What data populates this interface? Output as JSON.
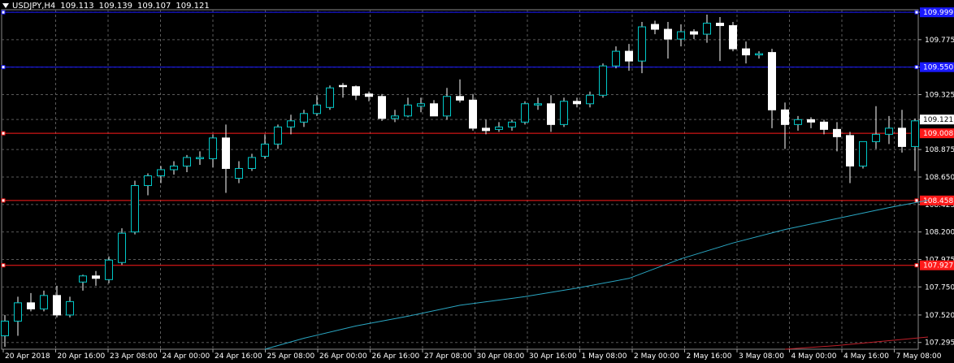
{
  "header": {
    "symbol": "USDJPY,H4",
    "open": "109.113",
    "high": "109.139",
    "low": "109.107",
    "close": "109.121"
  },
  "colors": {
    "background": "#000000",
    "grid": "#5a5a5a",
    "bull_body": "#000000",
    "bull_outline": "#00c8c8",
    "bear_body": "#ffffff",
    "wick": "#ffffff",
    "ma": "#2aa6c2",
    "ma_red": "#c0202a",
    "level_blue": "#1a1aff",
    "level_red": "#ff1a1a",
    "text": "#ffffff"
  },
  "chart_data": {
    "type": "candlestick",
    "timeframe": "H4",
    "y_ticks": [
      "110.000",
      "109.775",
      "109.550",
      "109.325",
      "109.121",
      "108.875",
      "108.650",
      "108.425",
      "108.200",
      "107.975",
      "107.750",
      "107.520",
      "107.295"
    ],
    "ylim": [
      107.24,
      110.02
    ],
    "x_tick_labels": [
      "20 Apr 2018",
      "20 Apr 16:00",
      "23 Apr 08:00",
      "24 Apr 00:00",
      "24 Apr 16:00",
      "25 Apr 08:00",
      "26 Apr 00:00",
      "26 Apr 16:00",
      "27 Apr 08:00",
      "30 Apr 08:00",
      "30 Apr 16:00",
      "1 May 08:00",
      "2 May 00:00",
      "2 May 16:00",
      "3 May 08:00",
      "4 May 00:00",
      "4 May 16:00",
      "7 May 08:00"
    ],
    "current_price": "109.121",
    "horizontal_levels": [
      {
        "price": 109.999,
        "label": "109.999",
        "color": "blue"
      },
      {
        "price": 109.55,
        "label": "109.550",
        "color": "blue"
      },
      {
        "price": 109.008,
        "label": "109.008",
        "color": "red"
      },
      {
        "price": 108.458,
        "label": "108.458",
        "color": "red"
      },
      {
        "price": 107.927,
        "label": "107.927",
        "color": "red"
      }
    ],
    "candles": [
      {
        "o": 107.35,
        "h": 107.52,
        "l": 107.26,
        "c": 107.47
      },
      {
        "o": 107.47,
        "h": 107.67,
        "l": 107.35,
        "c": 107.62
      },
      {
        "o": 107.62,
        "h": 107.7,
        "l": 107.55,
        "c": 107.57
      },
      {
        "o": 107.57,
        "h": 107.72,
        "l": 107.55,
        "c": 107.68
      },
      {
        "o": 107.68,
        "h": 107.76,
        "l": 107.5,
        "c": 107.52
      },
      {
        "o": 107.52,
        "h": 107.67,
        "l": 107.5,
        "c": 107.63
      },
      {
        "o": 107.79,
        "h": 107.85,
        "l": 107.72,
        "c": 107.84
      },
      {
        "o": 107.84,
        "h": 107.88,
        "l": 107.76,
        "c": 107.82
      },
      {
        "o": 107.81,
        "h": 108.0,
        "l": 107.78,
        "c": 107.97
      },
      {
        "o": 107.95,
        "h": 108.23,
        "l": 107.93,
        "c": 108.19
      },
      {
        "o": 108.2,
        "h": 108.62,
        "l": 108.18,
        "c": 108.58
      },
      {
        "o": 108.58,
        "h": 108.68,
        "l": 108.5,
        "c": 108.66
      },
      {
        "o": 108.66,
        "h": 108.74,
        "l": 108.6,
        "c": 108.71
      },
      {
        "o": 108.71,
        "h": 108.78,
        "l": 108.67,
        "c": 108.74
      },
      {
        "o": 108.74,
        "h": 108.83,
        "l": 108.69,
        "c": 108.81
      },
      {
        "o": 108.8,
        "h": 108.86,
        "l": 108.75,
        "c": 108.81
      },
      {
        "o": 108.8,
        "h": 109.0,
        "l": 108.73,
        "c": 108.97
      },
      {
        "o": 108.97,
        "h": 109.08,
        "l": 108.52,
        "c": 108.72
      },
      {
        "o": 108.64,
        "h": 108.78,
        "l": 108.6,
        "c": 108.72
      },
      {
        "o": 108.72,
        "h": 108.84,
        "l": 108.7,
        "c": 108.81
      },
      {
        "o": 108.82,
        "h": 109.0,
        "l": 108.8,
        "c": 108.92
      },
      {
        "o": 108.92,
        "h": 109.08,
        "l": 108.88,
        "c": 109.06
      },
      {
        "o": 109.06,
        "h": 109.16,
        "l": 109.0,
        "c": 109.11
      },
      {
        "o": 109.1,
        "h": 109.2,
        "l": 109.06,
        "c": 109.17
      },
      {
        "o": 109.17,
        "h": 109.32,
        "l": 109.15,
        "c": 109.24
      },
      {
        "o": 109.22,
        "h": 109.4,
        "l": 109.2,
        "c": 109.38
      },
      {
        "o": 109.4,
        "h": 109.42,
        "l": 109.3,
        "c": 109.39
      },
      {
        "o": 109.39,
        "h": 109.4,
        "l": 109.28,
        "c": 109.32
      },
      {
        "o": 109.33,
        "h": 109.35,
        "l": 109.27,
        "c": 109.31
      },
      {
        "o": 109.31,
        "h": 109.33,
        "l": 109.11,
        "c": 109.13
      },
      {
        "o": 109.13,
        "h": 109.2,
        "l": 109.1,
        "c": 109.15
      },
      {
        "o": 109.15,
        "h": 109.3,
        "l": 109.14,
        "c": 109.24
      },
      {
        "o": 109.23,
        "h": 109.3,
        "l": 109.18,
        "c": 109.25
      },
      {
        "o": 109.25,
        "h": 109.28,
        "l": 109.18,
        "c": 109.15
      },
      {
        "o": 109.15,
        "h": 109.38,
        "l": 109.12,
        "c": 109.31
      },
      {
        "o": 109.31,
        "h": 109.45,
        "l": 109.26,
        "c": 109.28
      },
      {
        "o": 109.28,
        "h": 109.33,
        "l": 109.03,
        "c": 109.05
      },
      {
        "o": 109.05,
        "h": 109.12,
        "l": 109.0,
        "c": 109.03
      },
      {
        "o": 109.04,
        "h": 109.1,
        "l": 109.02,
        "c": 109.06
      },
      {
        "o": 109.06,
        "h": 109.12,
        "l": 109.03,
        "c": 109.1
      },
      {
        "o": 109.1,
        "h": 109.27,
        "l": 109.08,
        "c": 109.25
      },
      {
        "o": 109.24,
        "h": 109.3,
        "l": 109.2,
        "c": 109.25
      },
      {
        "o": 109.25,
        "h": 109.32,
        "l": 109.02,
        "c": 109.08
      },
      {
        "o": 109.08,
        "h": 109.3,
        "l": 109.06,
        "c": 109.27
      },
      {
        "o": 109.27,
        "h": 109.3,
        "l": 109.22,
        "c": 109.25
      },
      {
        "o": 109.25,
        "h": 109.35,
        "l": 109.22,
        "c": 109.32
      },
      {
        "o": 109.32,
        "h": 109.58,
        "l": 109.3,
        "c": 109.56
      },
      {
        "o": 109.56,
        "h": 109.72,
        "l": 109.54,
        "c": 109.68
      },
      {
        "o": 109.68,
        "h": 109.74,
        "l": 109.52,
        "c": 109.6
      },
      {
        "o": 109.6,
        "h": 109.92,
        "l": 109.5,
        "c": 109.88
      },
      {
        "o": 109.9,
        "h": 109.93,
        "l": 109.82,
        "c": 109.86
      },
      {
        "o": 109.86,
        "h": 109.92,
        "l": 109.62,
        "c": 109.78
      },
      {
        "o": 109.78,
        "h": 109.9,
        "l": 109.72,
        "c": 109.84
      },
      {
        "o": 109.84,
        "h": 109.86,
        "l": 109.78,
        "c": 109.82
      },
      {
        "o": 109.82,
        "h": 109.98,
        "l": 109.75,
        "c": 109.91
      },
      {
        "o": 109.91,
        "h": 109.96,
        "l": 109.6,
        "c": 109.89
      },
      {
        "o": 109.89,
        "h": 109.92,
        "l": 109.68,
        "c": 109.7
      },
      {
        "o": 109.7,
        "h": 109.76,
        "l": 109.58,
        "c": 109.65
      },
      {
        "o": 109.65,
        "h": 109.68,
        "l": 109.62,
        "c": 109.66
      },
      {
        "o": 109.67,
        "h": 109.7,
        "l": 109.05,
        "c": 109.2
      },
      {
        "o": 109.2,
        "h": 109.26,
        "l": 108.88,
        "c": 109.08
      },
      {
        "o": 109.08,
        "h": 109.15,
        "l": 109.03,
        "c": 109.12
      },
      {
        "o": 109.12,
        "h": 109.14,
        "l": 109.05,
        "c": 109.1
      },
      {
        "o": 109.1,
        "h": 109.12,
        "l": 109.0,
        "c": 109.04
      },
      {
        "o": 109.04,
        "h": 109.1,
        "l": 108.86,
        "c": 108.98
      },
      {
        "o": 108.99,
        "h": 109.02,
        "l": 108.6,
        "c": 108.74
      },
      {
        "o": 108.74,
        "h": 108.9,
        "l": 108.72,
        "c": 108.94
      },
      {
        "o": 108.94,
        "h": 109.23,
        "l": 108.88,
        "c": 109.0
      },
      {
        "o": 109.0,
        "h": 109.15,
        "l": 108.92,
        "c": 109.05
      },
      {
        "o": 109.05,
        "h": 109.2,
        "l": 108.85,
        "c": 108.9
      },
      {
        "o": 108.9,
        "h": 109.13,
        "l": 108.7,
        "c": 109.11
      },
      {
        "o": 109.11,
        "h": 109.14,
        "l": 109.1,
        "c": 109.12
      }
    ],
    "moving_average": [
      {
        "bar": 20,
        "value": 107.24
      },
      {
        "bar": 23,
        "value": 107.33
      },
      {
        "bar": 27,
        "value": 107.43
      },
      {
        "bar": 31,
        "value": 107.51
      },
      {
        "bar": 35,
        "value": 107.6
      },
      {
        "bar": 40,
        "value": 107.67
      },
      {
        "bar": 44,
        "value": 107.74
      },
      {
        "bar": 48,
        "value": 107.82
      },
      {
        "bar": 52,
        "value": 107.98
      },
      {
        "bar": 56,
        "value": 108.11
      },
      {
        "bar": 60,
        "value": 108.22
      },
      {
        "bar": 64,
        "value": 108.31
      },
      {
        "bar": 68,
        "value": 108.4
      },
      {
        "bar": 71,
        "value": 108.46
      }
    ],
    "moving_average_red": [
      {
        "bar": 60,
        "value": 107.24
      },
      {
        "bar": 64,
        "value": 107.27
      },
      {
        "bar": 68,
        "value": 107.31
      },
      {
        "bar": 71,
        "value": 107.34
      }
    ]
  }
}
